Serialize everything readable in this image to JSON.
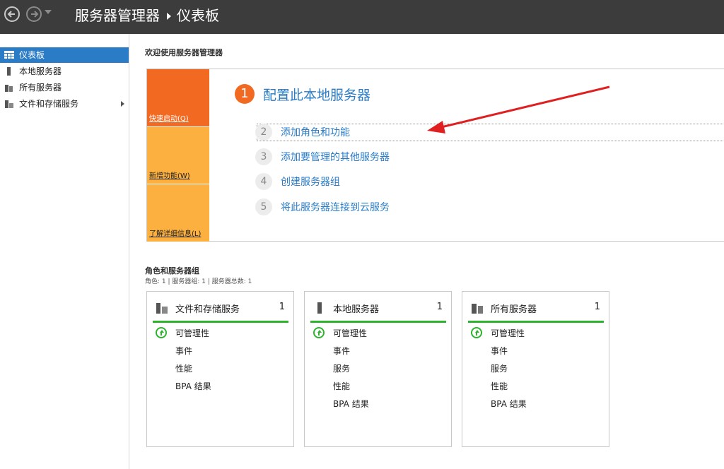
{
  "title_bar": {
    "breadcrumb_root": "服务器管理器",
    "breadcrumb_page": "仪表板"
  },
  "sidebar": {
    "items": [
      {
        "label": "仪表板",
        "icon": "dashboard-icon"
      },
      {
        "label": "本地服务器",
        "icon": "server-icon"
      },
      {
        "label": "所有服务器",
        "icon": "servers-icon"
      },
      {
        "label": "文件和存储服务",
        "icon": "file-storage-icon"
      }
    ]
  },
  "welcome": {
    "title": "欢迎使用服务器管理器",
    "quick_tiles": [
      "快速启动(Q)",
      "新增功能(W)",
      "了解详细信息(L)"
    ],
    "steps": [
      {
        "num": "1",
        "label": "配置此本地服务器"
      },
      {
        "num": "2",
        "label": "添加角色和功能"
      },
      {
        "num": "3",
        "label": "添加要管理的其他服务器"
      },
      {
        "num": "4",
        "label": "创建服务器组"
      },
      {
        "num": "5",
        "label": "将此服务器连接到云服务"
      }
    ]
  },
  "groups": {
    "title": "角色和服务器组",
    "summary": "角色: 1 | 服务器组: 1 | 服务器总数: 1",
    "cards": [
      {
        "title": "文件和存储服务",
        "count": "1",
        "rows": [
          "可管理性",
          "事件",
          "性能",
          "BPA 结果"
        ]
      },
      {
        "title": "本地服务器",
        "count": "1",
        "rows": [
          "可管理性",
          "事件",
          "服务",
          "性能",
          "BPA 结果"
        ]
      },
      {
        "title": "所有服务器",
        "count": "1",
        "rows": [
          "可管理性",
          "事件",
          "服务",
          "性能",
          "BPA 结果"
        ]
      }
    ]
  },
  "colors": {
    "accent": "#2a7cc7",
    "orange": "#f26a22",
    "amber": "#fbb040",
    "status_ok": "#2cb52c",
    "annotation_arrow": "#e02020"
  }
}
